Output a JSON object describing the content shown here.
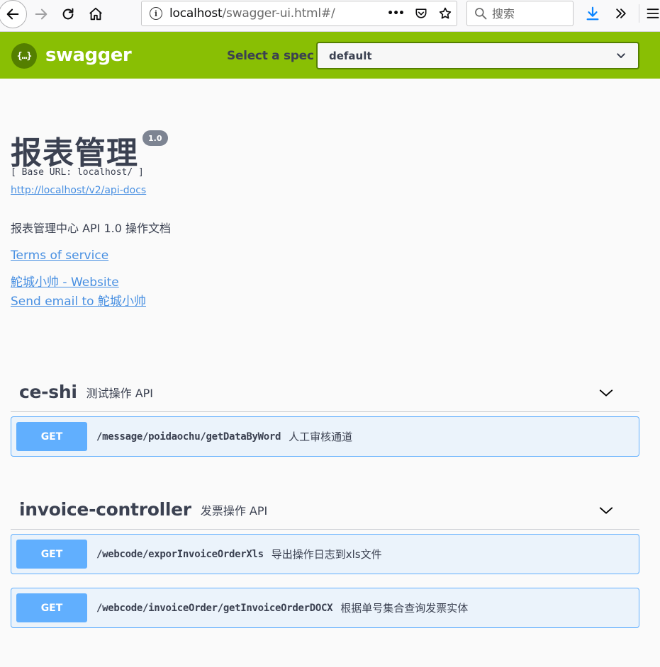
{
  "browser": {
    "url_host": "localhost",
    "url_path": "/swagger-ui.html#/",
    "search_placeholder": "搜索",
    "more_actions": "•••"
  },
  "topbar": {
    "logo_glyph": "{…}",
    "brand": "swagger",
    "spec_label": "Select a spec",
    "spec_selected": "default"
  },
  "info": {
    "title": "报表管理",
    "version": "1.0",
    "base_url": "[ Base URL: localhost/ ]",
    "api_docs_url": "http://localhost/v2/api-docs",
    "description": "报表管理中心 API 1.0 操作文档",
    "terms_link": "Terms of service",
    "website_link": "鮀城小帅 - Website",
    "email_link": "Send email to 鮀城小帅"
  },
  "tags": [
    {
      "name": "ce-shi",
      "description": "测试操作 API",
      "operations": [
        {
          "method": "GET",
          "path": "/message/poidaochu/getDataByWord",
          "summary": "人工审核通道"
        }
      ]
    },
    {
      "name": "invoice-controller",
      "description": "发票操作 API",
      "operations": [
        {
          "method": "GET",
          "path": "/webcode/exporInvoiceOrderXls",
          "summary": "导出操作日志到xls文件"
        },
        {
          "method": "GET",
          "path": "/webcode/invoiceOrder/getInvoiceOrderDOCX",
          "summary": "根据单号集合查询发票实体"
        }
      ]
    }
  ],
  "colors": {
    "topbar": "#89bf04",
    "get_method": "#61affe",
    "get_background": "#ebf3fb",
    "link": "#4990e2",
    "text": "#3b4151"
  },
  "icons": [
    "back-arrow-icon",
    "forward-arrow-icon",
    "reload-icon",
    "home-icon",
    "info-icon",
    "pocket-icon",
    "star-icon",
    "search-icon",
    "download-icon",
    "overflow-chevron-icon",
    "hamburger-menu-icon",
    "chevron-down-icon"
  ]
}
